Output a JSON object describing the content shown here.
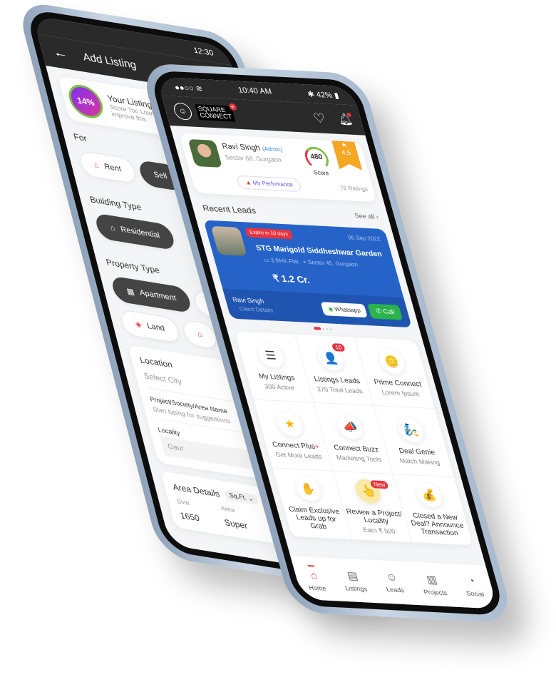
{
  "add_listing": {
    "status_time": "12:30",
    "title": "Add Listing",
    "score": {
      "percent": "14%",
      "title": "Your Listing Score",
      "line1": "Score Too Low! A",
      "line2": "improve this."
    },
    "for_label": "For",
    "for_options": [
      "Rent",
      "Sell"
    ],
    "building_label": "Building Type",
    "building_options": [
      "Residential"
    ],
    "property_label": "Property Type",
    "property_options": [
      "Apartment",
      "Land"
    ],
    "location": {
      "title": "Location",
      "city_placeholder": "Select City",
      "project_label": "Project/Society/Area Name",
      "project_placeholder": "Start typing for suggestions",
      "locality_label": "Locality",
      "locality_value": "Gaur"
    },
    "area": {
      "title": "Area Details",
      "unit": "Sq.Ft.",
      "size_label": "Size",
      "area_label": "Area",
      "size_value": "1650",
      "area_value": "Super"
    }
  },
  "home": {
    "status": {
      "time": "10:40 AM",
      "battery": "42%"
    },
    "logo": {
      "line1": "SQUARE",
      "line2": "CONNECT"
    },
    "profile": {
      "name": "Ravi Singh",
      "role": "(Admin)",
      "location": "Sector 68, Gurgaon",
      "score": "480",
      "score_label": "Score",
      "rating": "4.5",
      "ratings": "72 Ratings",
      "performance": "My Perfomance"
    },
    "recent": {
      "title": "Recent Leads",
      "see_all": "See all"
    },
    "lead": {
      "expire": "Expire in 10 days",
      "date": "06 Sep 2022",
      "name": "STG Marigold Siddheshwar Garden",
      "type": "3 BHK Flat",
      "location": "Sector 45, Gurgaon",
      "price": "₹ 1.2 Cr.",
      "client": "Ravi Singh",
      "client_sub": "Client Details",
      "whatsapp": "Whatsapp",
      "call": "Call"
    },
    "grid": [
      {
        "title": "My Listings",
        "sub": "300 Active",
        "icon": "list-icon",
        "glyph": "☰"
      },
      {
        "title": "Listings Leads",
        "sub": "270 Total Leads",
        "icon": "leads-icon",
        "glyph": "👤",
        "badge": "10"
      },
      {
        "title": "Prime Connect",
        "sub": "Lorem Ipsum",
        "icon": "coins-icon",
        "glyph": "🪙"
      },
      {
        "title": "Connect Plus",
        "sub": "Get More Leads",
        "icon": "star-icon",
        "glyph": "★",
        "plus": "+"
      },
      {
        "title": "Connect Buzz",
        "sub": "Marketing Tools",
        "icon": "megaphone-icon",
        "glyph": "📣"
      },
      {
        "title": "Deal Genie",
        "sub": "Match Making",
        "icon": "genie-icon",
        "glyph": "🧞"
      },
      {
        "title": "Claim Exclusive Leads up for Grab",
        "sub": "",
        "icon": "claim-icon",
        "glyph": "✋"
      },
      {
        "title": "Review a Project/ Locality",
        "sub": "Earn ₹ 500",
        "icon": "review-icon",
        "glyph": "👆",
        "badge": "New"
      },
      {
        "title": "Closed a New Deal? Announce Transaction",
        "sub": "",
        "icon": "deal-icon",
        "glyph": "💰"
      }
    ],
    "nav": [
      {
        "label": "Home",
        "glyph": "⌂"
      },
      {
        "label": "Listings",
        "glyph": "▤"
      },
      {
        "label": "Leads",
        "glyph": "☺"
      },
      {
        "label": "Projects",
        "glyph": "▥"
      },
      {
        "label": "Social",
        "glyph": "◔"
      }
    ],
    "colors": {
      "accent": "#e8343f",
      "lead_card": "#2563c9",
      "call": "#2bb24c",
      "rating": "#f5a623",
      "dark": "#2a2a2a"
    }
  }
}
